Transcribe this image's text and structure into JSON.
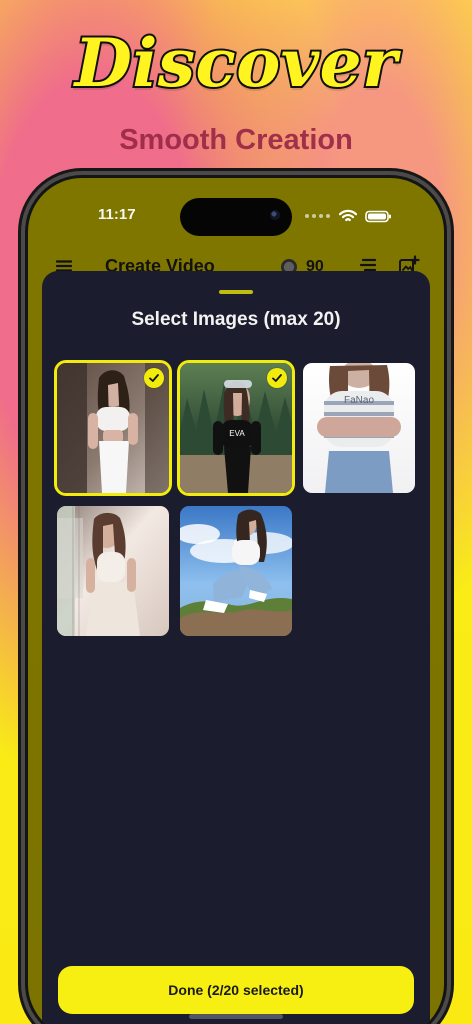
{
  "hero": {
    "title": "Discover",
    "subtitle": "Smooth Creation"
  },
  "status_bar": {
    "time": "11:17",
    "wifi_icon": "wifi-icon",
    "battery_icon": "battery-icon"
  },
  "app_bar": {
    "menu_icon": "menu-icon",
    "title": "Create Video",
    "coin_icon": "coin-icon",
    "coin_count": "90",
    "list_icon": "list-icon",
    "add_image_icon": "add-image-icon"
  },
  "sheet": {
    "title": "Select Images (max 20)",
    "done_label": "Done (2/20 selected)"
  },
  "images": [
    {
      "selected": true
    },
    {
      "selected": true
    },
    {
      "selected": false
    },
    {
      "selected": false
    },
    {
      "selected": false
    }
  ],
  "colors": {
    "accent": "#f2ec0c",
    "sheet_background": "#1b1d2e",
    "top_header": "#7f7600",
    "hero_subtitle": "#9c2b48"
  }
}
